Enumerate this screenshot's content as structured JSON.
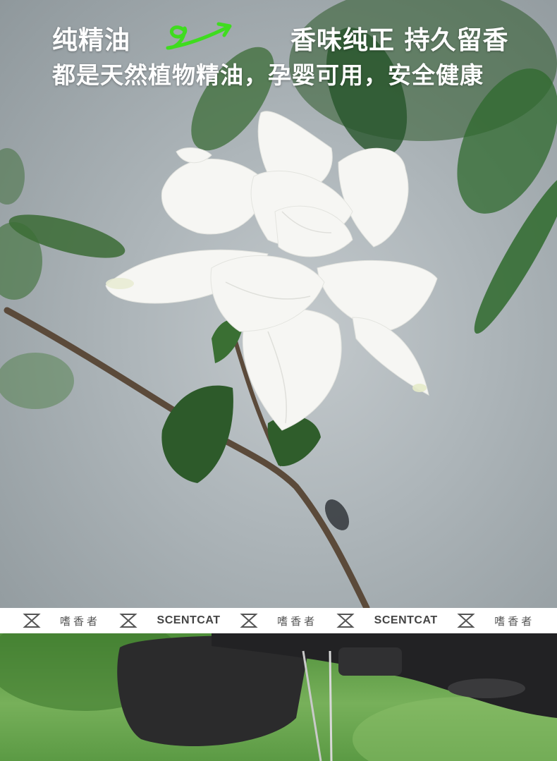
{
  "headline": {
    "left": "纯精油",
    "right": "香味纯正 持久留香",
    "sub": "都是天然植物精油，孕婴可用，安全健康"
  },
  "colors": {
    "accent_green": "#3fdc1f",
    "strip_bg": "#ffffff",
    "strip_text": "#444444"
  },
  "icons": {
    "squiggle": "green-squiggle-arrow-icon",
    "strip_separator": "hourglass-logo-icon"
  },
  "brand_strip": {
    "items": [
      {
        "type": "icon"
      },
      {
        "type": "text",
        "label": "嗜香者"
      },
      {
        "type": "icon"
      },
      {
        "type": "text",
        "label": "SCENTCAT"
      },
      {
        "type": "icon"
      },
      {
        "type": "text",
        "label": "嗜香者"
      },
      {
        "type": "icon"
      },
      {
        "type": "text",
        "label": "SCENTCAT"
      },
      {
        "type": "icon"
      },
      {
        "type": "text",
        "label": "嗜香者"
      }
    ]
  }
}
